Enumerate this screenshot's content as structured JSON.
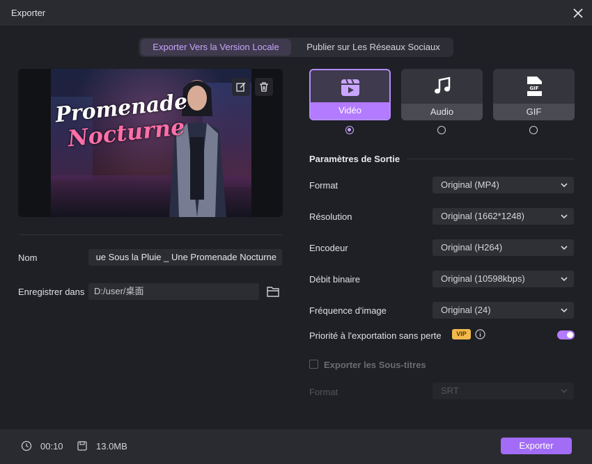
{
  "window": {
    "title": "Exporter"
  },
  "tabs": {
    "local": "Exporter Vers la Version Locale",
    "social": "Publier sur Les Réseaux Sociaux"
  },
  "preview": {
    "title_line1": "Promenade",
    "title_line2": "Nocturne"
  },
  "form": {
    "name_label": "Nom",
    "name_value": "ue Sous la Pluie _ Une Promenade Nocturne",
    "save_label": "Enregistrer dans",
    "save_value": "D:/user/桌面"
  },
  "types": [
    {
      "label": "Vidéo",
      "icon": "video-clapper-icon",
      "selected": true
    },
    {
      "label": "Audio",
      "icon": "music-note-icon",
      "selected": false
    },
    {
      "label": "GIF",
      "icon": "gif-file-icon",
      "selected": false
    }
  ],
  "output": {
    "section_title": "Paramètres de Sortie",
    "rows": [
      {
        "label": "Format",
        "value": "Original (MP4)"
      },
      {
        "label": "Résolution",
        "value": "Original (1662*1248)"
      },
      {
        "label": "Encodeur",
        "value": "Original (H264)"
      },
      {
        "label": "Débit binaire",
        "value": "Original (10598kbps)"
      },
      {
        "label": "Fréquence d'image",
        "value": "Original (24)"
      }
    ],
    "lossless_label": "Priorité à l'exportation sans perte",
    "vip_badge": "VIP",
    "lossless_on": true,
    "subtitles_label": "Exporter les Sous-titres",
    "subtitles_checked": false,
    "subtitle_format_label": "Format",
    "subtitle_format_value": "SRT"
  },
  "footer": {
    "duration": "00:10",
    "size": "13.0MB",
    "export_button": "Exporter"
  },
  "colors": {
    "accent": "#b37bff",
    "button": "#a26cf6",
    "background": "#1f2025",
    "vip": "#f2b94c"
  }
}
